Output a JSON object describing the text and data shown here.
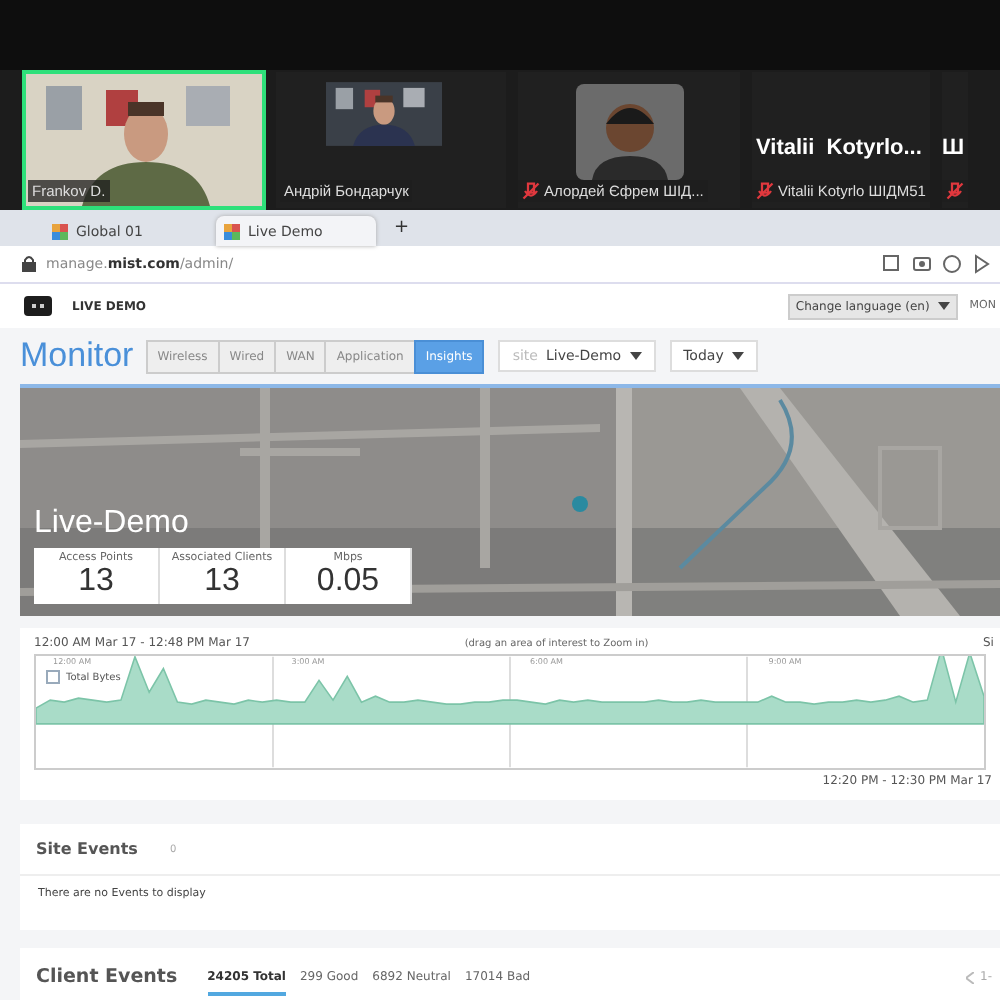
{
  "participants": [
    {
      "kind": "video",
      "name": "Frankov D.",
      "speaking": true,
      "muted": false
    },
    {
      "kind": "video",
      "name": "Андрій Бондарчук",
      "speaking": false,
      "muted": false
    },
    {
      "kind": "avatar",
      "name": "Алордей Єфрем ШІД...",
      "speaking": false,
      "muted": true
    },
    {
      "kind": "name",
      "title": "Vitalii  Kotyrlo...",
      "name": "Vitalii Kotyrlo ШІДМ51",
      "speaking": false,
      "muted": true
    },
    {
      "kind": "name",
      "title": "Ш",
      "speaking": false,
      "muted": true
    }
  ],
  "browser": {
    "tabs": [
      {
        "label": "Global 01",
        "selected": false
      },
      {
        "label": "Live Demo",
        "selected": true
      }
    ],
    "new_tab": "+",
    "address": "manage.**mist.com**/admin/"
  },
  "header": {
    "brand": "LIVE DEMO",
    "language": "Change language (en)",
    "cut_text": "MON"
  },
  "monitor": {
    "title": "Monitor",
    "tabs": [
      {
        "label": "Wireless",
        "selected": false
      },
      {
        "label": "Wired",
        "selected": false
      },
      {
        "label": "WAN",
        "selected": false
      },
      {
        "label": "Application",
        "selected": false
      },
      {
        "label": "Insights",
        "selected": true
      }
    ],
    "site_prefix": "site",
    "site": "Live-Demo",
    "period": "Today"
  },
  "site_card": {
    "name": "Live-Demo",
    "stats": [
      {
        "label": "Access Points",
        "value": "13"
      },
      {
        "label": "Associated Clients",
        "value": "13"
      },
      {
        "label": "Mbps",
        "value": "0.05"
      }
    ]
  },
  "timeline": {
    "range": "12:00 AM Mar 17 - 12:48 PM Mar 17",
    "hint": "(drag an area of interest to Zoom in)",
    "cut_text": "Si",
    "legend": "Total Bytes",
    "legend_checked": false,
    "time_labels": [
      "12:00 AM",
      "3:00 AM",
      "6:00 AM",
      "9:00 AM"
    ],
    "selection": "12:20 PM - 12:30 PM Mar 17"
  },
  "site_events": {
    "title": "Site Events",
    "count": "0",
    "empty": "There are no Events to display"
  },
  "client_events": {
    "title": "Client Events",
    "filters": [
      {
        "label": "24205 Total",
        "selected": true
      },
      {
        "label": "299 Good",
        "selected": false
      },
      {
        "label": "6892 Neutral",
        "selected": false
      },
      {
        "label": "17014 Bad",
        "selected": false
      }
    ],
    "pager": "1-"
  }
}
